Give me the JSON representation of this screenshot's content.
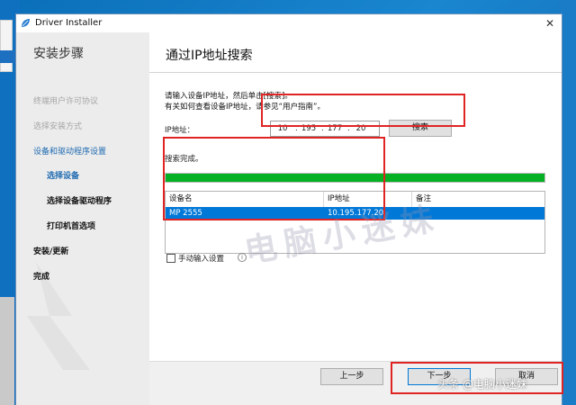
{
  "window": {
    "title": "Driver Installer",
    "close_glyph": "✕",
    "accent_color": "#0078d7",
    "app_icon": "leaf-icon"
  },
  "sidebar": {
    "title": "安装步骤",
    "steps": [
      {
        "label": "终端用户许可协议",
        "state": "done"
      },
      {
        "label": "选择安装方式",
        "state": "done"
      },
      {
        "label": "设备和驱动程序设置",
        "state": "active-parent"
      },
      {
        "label": "选择设备",
        "state": "current"
      },
      {
        "label": "选择设备驱动程序",
        "state": "pending"
      },
      {
        "label": "打印机首选项",
        "state": "pending"
      },
      {
        "label": "安装/更新",
        "state": "pending"
      },
      {
        "label": "完成",
        "state": "pending"
      }
    ]
  },
  "content": {
    "title": "通过IP地址搜索",
    "instruction_line1": "请输入设备IP地址，然后单击[搜索]。",
    "instruction_line2": "有关如何查看设备IP地址，请参见“用户指南”。",
    "ip_label": "IP地址：",
    "ip_segments": [
      "10",
      "195",
      "177",
      "20"
    ],
    "search_button": "搜索",
    "status_text": "搜索完成。",
    "progress_percent": 100,
    "progress_color": "#06b025",
    "table": {
      "columns": [
        "设备名",
        "IP地址",
        "备注"
      ],
      "rows": [
        {
          "name": "MP 2555",
          "ip": "10.195.177.20",
          "note": ""
        }
      ]
    },
    "manual_checkbox_label": "手动输入设置",
    "manual_checked": false,
    "info_icon": "info-icon"
  },
  "footer": {
    "back_label": "上一步",
    "next_label": "下一步",
    "cancel_label": "取消"
  },
  "overlay": {
    "highlight_color": "#e02424",
    "watermark": "电脑小迷妹",
    "credit": "头条 @电脑小迷妹"
  }
}
